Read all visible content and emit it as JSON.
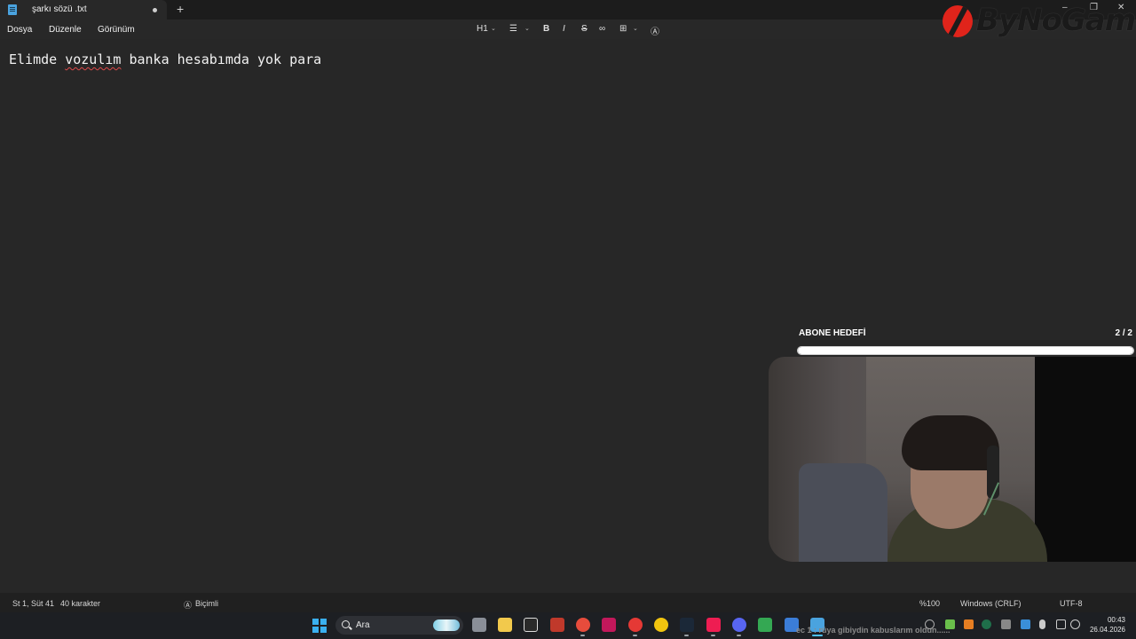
{
  "window": {
    "tab_title": "şarkı sözü .txt",
    "new_tab_symbol": "+",
    "controls": {
      "minimize": "–",
      "restore": "❐",
      "close": "✕"
    }
  },
  "menu": {
    "file": "Dosya",
    "edit": "Düzenle",
    "view": "Görünüm"
  },
  "toolbar": {
    "heading": "H1",
    "list_icon": "list-icon",
    "bold": "B",
    "italic": "I",
    "strikethrough": "S",
    "link_icon": "link-icon",
    "table_icon": "table-icon",
    "clear_format_icon": "clear-formatting-icon"
  },
  "editor": {
    "before": "Elimde ",
    "misspelled": "vozulım",
    "after": " banka hesabımda yok para"
  },
  "overlay": {
    "goal_title": "ABONE HEDEFİ",
    "goal_count": "2 / 2",
    "goal_progress": 1.0,
    "logo_text": "ByNoGame"
  },
  "status": {
    "position": "St 1, Süt 41",
    "char_count": "40 karakter",
    "format": "Biçimli",
    "zoom": "%100",
    "line_ending": "Windows (CRLF)",
    "encoding": "UTF-8"
  },
  "taskbar": {
    "search_placeholder": "Ara",
    "ticker": "ec 1   : rüya gibiydin kabuslarım oldun......",
    "time": "00:43",
    "date": "26.04.2026"
  },
  "colors": {
    "accent": "#4cc2ff",
    "misspell": "#e04a4a",
    "logo_red": "#e0241b"
  }
}
